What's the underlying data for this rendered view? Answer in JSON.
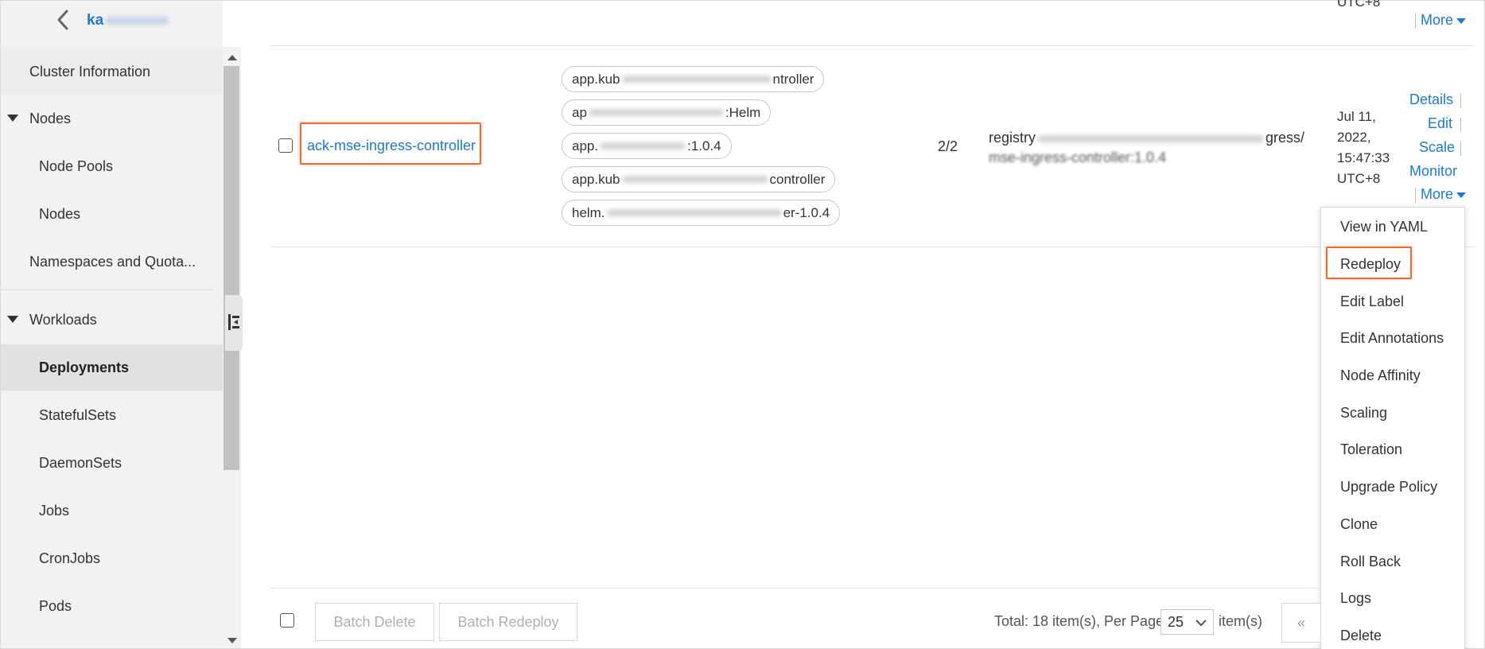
{
  "sidebar": {
    "cluster_name": "ka",
    "items": [
      {
        "label": "Cluster Information"
      },
      {
        "label": "Nodes"
      },
      {
        "label": "Node Pools"
      },
      {
        "label": "Nodes"
      },
      {
        "label": "Namespaces and Quota..."
      },
      {
        "label": "Workloads"
      },
      {
        "label": "Deployments"
      },
      {
        "label": "StatefulSets"
      },
      {
        "label": "DaemonSets"
      },
      {
        "label": "Jobs"
      },
      {
        "label": "CronJobs"
      },
      {
        "label": "Pods"
      }
    ]
  },
  "table": {
    "prev_row": {
      "created_tail": "UTC+8",
      "more_label": "More"
    },
    "row": {
      "name": "ack-mse-ingress-controller",
      "labels": [
        {
          "prefix": "app.kub",
          "suffix": "ntroller"
        },
        {
          "prefix": "ap",
          "suffix": ":Helm"
        },
        {
          "prefix": "app.",
          "suffix": ":1.0.4"
        },
        {
          "prefix": "app.kub",
          "suffix": "controller"
        },
        {
          "prefix": "helm.",
          "suffix": "er-1.0.4"
        }
      ],
      "pods": "2/2",
      "image_line1_prefix": "registry",
      "image_line1_suffix": "gress/",
      "image_line2": "mse-ingress-controller:1.0.4",
      "created_line1": "Jul 11,",
      "created_line2": "2022,",
      "created_line3": "15:47:33",
      "created_line4": "UTC+8",
      "actions": {
        "details": "Details",
        "edit": "Edit",
        "scale": "Scale",
        "monitor": "Monitor",
        "more": "More"
      }
    }
  },
  "more_menu": {
    "items": [
      "View in YAML",
      "Redeploy",
      "Edit Label",
      "Edit Annotations",
      "Node Affinity",
      "Scaling",
      "Toleration",
      "Upgrade Policy",
      "Clone",
      "Roll Back",
      "Logs",
      "Delete"
    ]
  },
  "footer": {
    "batch_delete": "Batch Delete",
    "batch_redeploy": "Batch Redeploy",
    "total_text": "Total: 18 item(s), Per Page:",
    "per_page": "25",
    "items_suffix": "item(s)",
    "prev_glyph": "«"
  },
  "colors": {
    "link": "#1a7ad9",
    "highlight": "#ef6d2c"
  }
}
